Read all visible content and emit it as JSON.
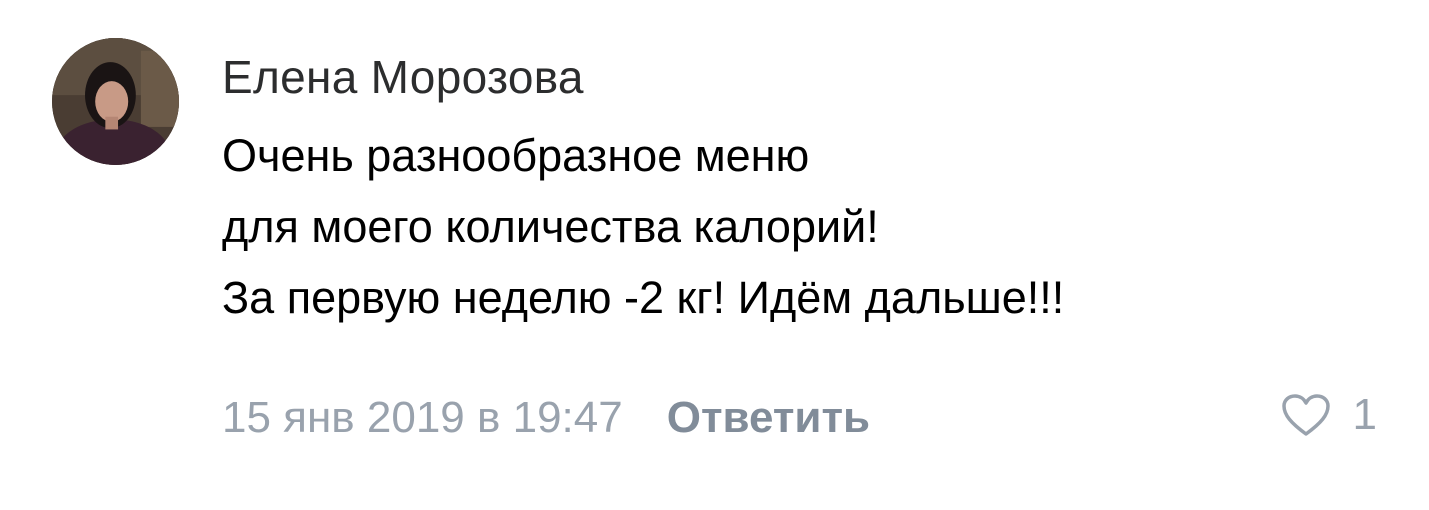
{
  "comment": {
    "author": "Елена Морозова",
    "text_lines": [
      "Очень разнообразное меню",
      "для моего количества калорий!",
      "За первую неделю -2 кг! Идём дальше!!!"
    ],
    "timestamp": "15 янв 2019 в 19:47",
    "reply_label": "Ответить",
    "likes_count": "1",
    "like_icon": "heart-outline-icon"
  },
  "colors": {
    "author": "#2c2d2e",
    "text": "#000000",
    "secondary": "#99a2ad",
    "reply": "#818c99"
  }
}
